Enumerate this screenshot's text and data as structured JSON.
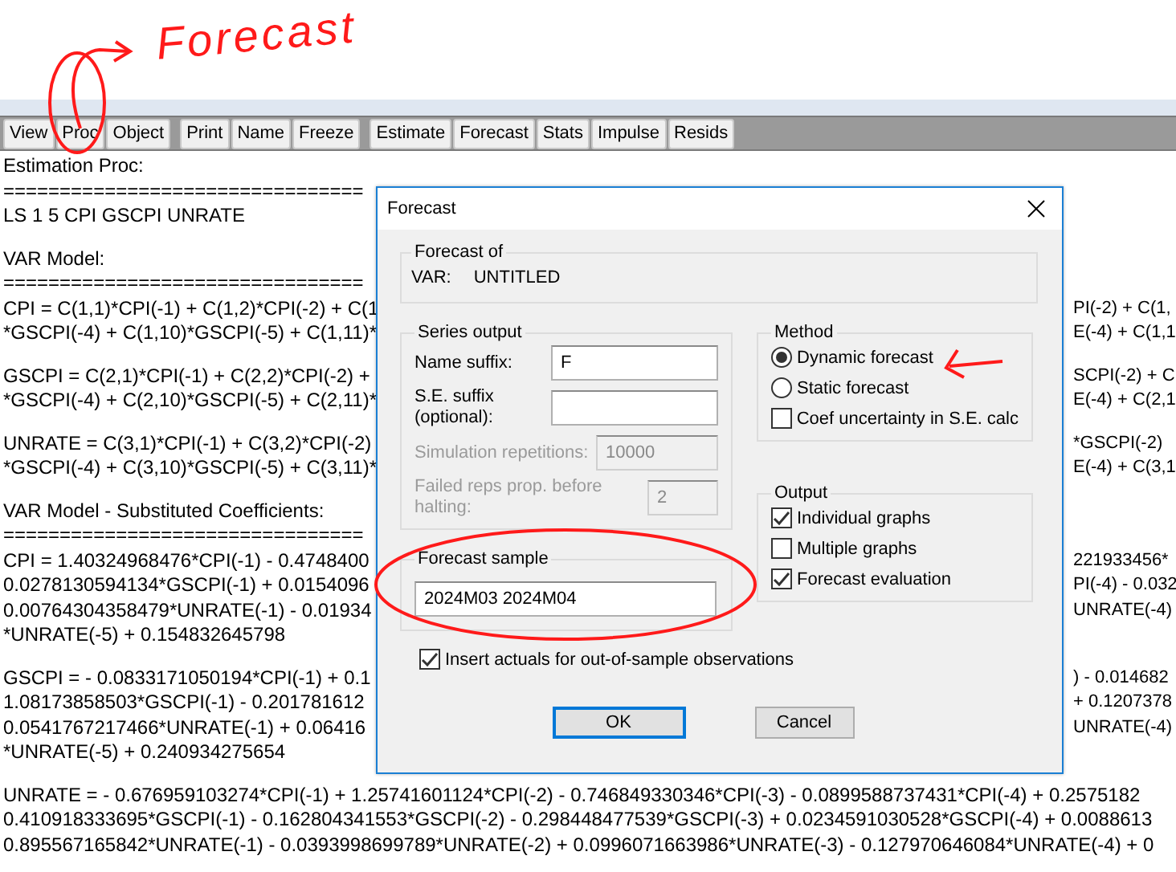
{
  "annotation": {
    "text": "Forecast"
  },
  "toolbar": [
    [
      "View",
      "Proc",
      "Object"
    ],
    [
      "Print",
      "Name",
      "Freeze"
    ],
    [
      "Estimate",
      "Forecast",
      "Stats",
      "Impulse",
      "Resids"
    ]
  ],
  "output_lines": [
    {
      "kind": "text",
      "left": "Estimation Proc:"
    },
    {
      "kind": "text",
      "left": "================================"
    },
    {
      "kind": "text",
      "left": "LS 1 5 CPI GSCPI UNRATE"
    },
    {
      "kind": "blank"
    },
    {
      "kind": "text",
      "left": "VAR Model:"
    },
    {
      "kind": "text",
      "left": "================================"
    },
    {
      "kind": "text",
      "left": "CPI = C(1,1)*CPI(-1) + C(1,2)*CPI(-2) + C(1",
      "right": "PI(-2) + C(1,"
    },
    {
      "kind": "text",
      "left": "*GSCPI(-4) + C(1,10)*GSCPI(-5) + C(1,11)*",
      "right": "E(-4) + C(1,1"
    },
    {
      "kind": "blank"
    },
    {
      "kind": "text",
      "left": "GSCPI = C(2,1)*CPI(-1) + C(2,2)*CPI(-2) +",
      "right": "SCPI(-2) + C"
    },
    {
      "kind": "text",
      "left": "*GSCPI(-4) + C(2,10)*GSCPI(-5) + C(2,11)*",
      "right": "E(-4) + C(2,1"
    },
    {
      "kind": "blank"
    },
    {
      "kind": "text",
      "left": "UNRATE = C(3,1)*CPI(-1) + C(3,2)*CPI(-2)",
      "right": "*GSCPI(-2)"
    },
    {
      "kind": "text",
      "left": "*GSCPI(-4) + C(3,10)*GSCPI(-5) + C(3,11)*",
      "right": "E(-4) + C(3,1"
    },
    {
      "kind": "blank"
    },
    {
      "kind": "text",
      "left": "VAR Model - Substituted Coefficients:"
    },
    {
      "kind": "text",
      "left": "================================"
    },
    {
      "kind": "text",
      "left": "CPI = 1.40324968476*CPI(-1) - 0.4748400",
      "right": "221933456*"
    },
    {
      "kind": "text",
      "left": "0.0278130594134*GSCPI(-1) + 0.0154096",
      "right": "PI(-4) - 0.032"
    },
    {
      "kind": "text",
      "left": "0.00764304358479*UNRATE(-1) - 0.01934",
      "right": "UNRATE(-4)"
    },
    {
      "kind": "text",
      "left": "*UNRATE(-5) + 0.154832645798"
    },
    {
      "kind": "blank"
    },
    {
      "kind": "text",
      "left": "GSCPI =  - 0.0833171050194*CPI(-1) + 0.1",
      "right": ") - 0.014682"
    },
    {
      "kind": "text",
      "left": "1.08173858503*GSCPI(-1) - 0.201781612",
      "right": "+ 0.1207378"
    },
    {
      "kind": "text",
      "left": "0.0541767217466*UNRATE(-1) + 0.06416",
      "right": "UNRATE(-4)"
    },
    {
      "kind": "text",
      "left": "*UNRATE(-5) + 0.240934275654"
    },
    {
      "kind": "blank"
    },
    {
      "kind": "text",
      "left": "UNRATE =  - 0.676959103274*CPI(-1) + 1.25741601124*CPI(-2) - 0.746849330346*CPI(-3) - 0.0899588737431*CPI(-4) + 0.2575182"
    },
    {
      "kind": "text",
      "left": "0.410918333695*GSCPI(-1) - 0.162804341553*GSCPI(-2) - 0.298448477539*GSCPI(-3) + 0.0234591030528*GSCPI(-4) + 0.0088613"
    },
    {
      "kind": "text",
      "left": "0.895567165842*UNRATE(-1) - 0.0393998699789*UNRATE(-2) + 0.0996071663986*UNRATE(-3) - 0.127970646084*UNRATE(-4) + 0"
    }
  ],
  "dialog": {
    "title": "Forecast",
    "forecast_of": {
      "legend": "Forecast of",
      "label": "VAR:",
      "value": "UNTITLED"
    },
    "series_output": {
      "legend": "Series output",
      "fields": [
        {
          "label": "Name suffix:",
          "value": "F",
          "disabled": false
        },
        {
          "label": "S.E. suffix (optional):",
          "disabled": false
        },
        {
          "label": "Simulation repetitions:",
          "value": "10000",
          "disabled": true
        },
        {
          "label": "Failed reps prop. before halting:",
          "value": "2",
          "disabled": true
        }
      ]
    },
    "method": {
      "legend": "Method",
      "options": [
        {
          "kind": "radio",
          "label": "Dynamic forecast",
          "selected": true
        },
        {
          "kind": "radio",
          "label": "Static forecast",
          "selected": false
        },
        {
          "kind": "checkbox",
          "label": "Coef uncertainty in S.E. calc",
          "checked": false
        }
      ]
    },
    "forecast_sample": {
      "legend": "Forecast sample",
      "value": "2024M03 2024M04"
    },
    "output": {
      "legend": "Output",
      "options": [
        {
          "label": "Individual graphs",
          "checked": true
        },
        {
          "label": "Multiple graphs",
          "checked": false
        },
        {
          "label": "Forecast evaluation",
          "checked": true
        }
      ]
    },
    "insert_actuals": {
      "label": "Insert actuals for out-of-sample observations",
      "checked": true
    },
    "buttons": [
      {
        "label": "OK",
        "default": true
      },
      {
        "label": "Cancel",
        "default": false
      }
    ]
  }
}
